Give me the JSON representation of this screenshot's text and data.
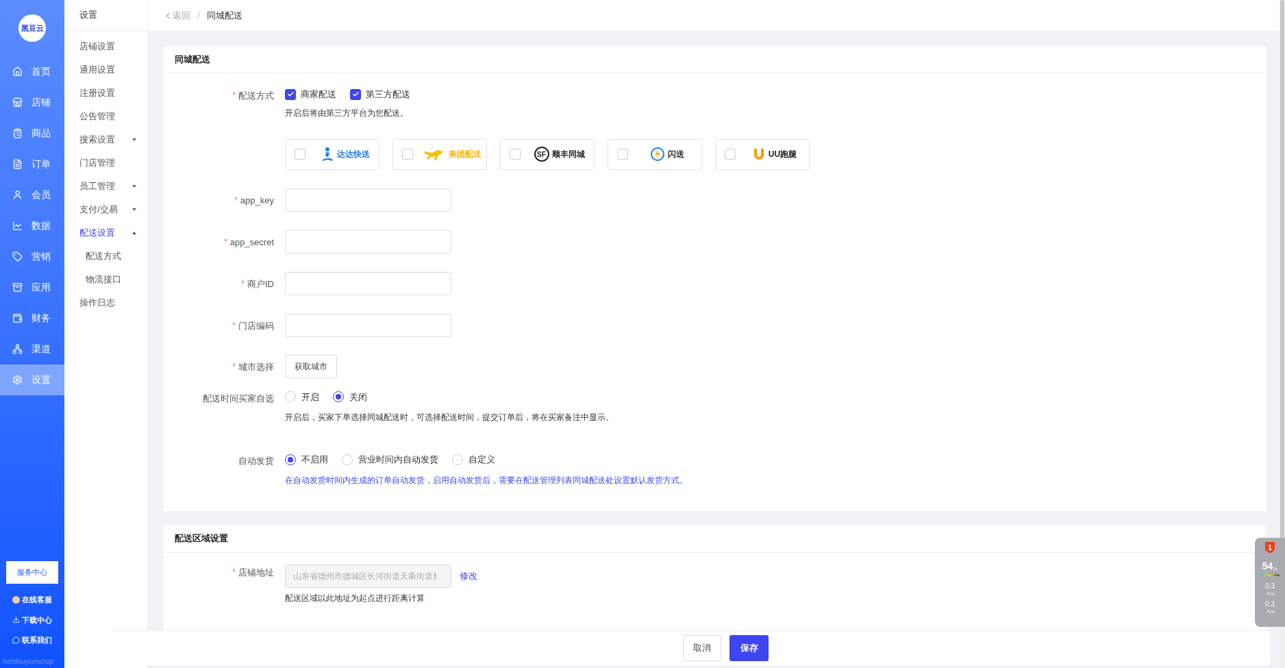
{
  "sidebar": {
    "logo": "黑豆云",
    "items": [
      {
        "label": "首页",
        "selected": false
      },
      {
        "label": "店铺",
        "selected": false
      },
      {
        "label": "商品",
        "selected": false
      },
      {
        "label": "订单",
        "selected": false
      },
      {
        "label": "会员",
        "selected": false
      },
      {
        "label": "数据",
        "selected": false
      },
      {
        "label": "营销",
        "selected": false
      },
      {
        "label": "应用",
        "selected": false
      },
      {
        "label": "财务",
        "selected": false
      },
      {
        "label": "渠道",
        "selected": false
      },
      {
        "label": "设置",
        "selected": true
      }
    ],
    "service_button": "服务中心",
    "links": [
      {
        "label": "在线客服"
      },
      {
        "label": "下载中心"
      },
      {
        "label": "联系我们"
      }
    ],
    "footer": "heidouyunshop"
  },
  "submenu": {
    "title": "设置",
    "items": [
      {
        "label": "店铺设置",
        "selected": false
      },
      {
        "label": "通用设置",
        "selected": false
      },
      {
        "label": "注册设置",
        "selected": false
      },
      {
        "label": "公告管理",
        "selected": false
      },
      {
        "label": "搜索设置",
        "selected": false,
        "expanded": false
      },
      {
        "label": "门店管理",
        "selected": false
      },
      {
        "label": "员工管理",
        "selected": false,
        "expanded": false
      },
      {
        "label": "支付/交易",
        "selected": false,
        "expanded": false
      },
      {
        "label": "配送设置",
        "selected": true,
        "expanded": true,
        "children": [
          {
            "label": "配送方式",
            "selected": false
          },
          {
            "label": "物流接口",
            "selected": false
          }
        ]
      },
      {
        "label": "操作日志",
        "selected": false
      }
    ]
  },
  "breadcrumb": {
    "back": "返回",
    "separator": "/",
    "current": "同城配送"
  },
  "section_delivery": {
    "title": "同城配送",
    "method": {
      "label": "配送方式",
      "required_mark": "*",
      "options": [
        {
          "label": "商家配送",
          "checked": true
        },
        {
          "label": "第三方配送",
          "checked": true
        }
      ],
      "hint": "开启后将由第三方平台为您配送。"
    },
    "providers": [
      {
        "name": "达达快送",
        "kind": "dada",
        "checked": false
      },
      {
        "name": "美团配送",
        "kind": "meituan",
        "checked": false
      },
      {
        "name": "顺丰同城",
        "kind": "sf",
        "logo_text": "SF",
        "checked": false
      },
      {
        "name": "闪送",
        "kind": "shansong",
        "checked": false
      },
      {
        "name": "UU跑腿",
        "kind": "uu",
        "checked": false
      }
    ],
    "fields": [
      {
        "label": "app_key",
        "required_mark": "*"
      },
      {
        "label": "app_secret",
        "required_mark": "*"
      },
      {
        "label": "商户ID",
        "required_mark": "*"
      },
      {
        "label": "门店编码",
        "required_mark": "*"
      }
    ],
    "city": {
      "label": "城市选择",
      "required_mark": "*",
      "button": "获取城市"
    },
    "buyer_time": {
      "label": "配送时间买家自选",
      "options": [
        {
          "label": "开启",
          "selected": false
        },
        {
          "label": "关闭",
          "selected": true
        }
      ],
      "hint": "开启后，买家下单选择同城配送时，可选择配送时间，提交订单后，将在买家备注中显示。"
    },
    "auto_ship": {
      "label": "自动发货",
      "options": [
        {
          "label": "不启用",
          "selected": true
        },
        {
          "label": "营业时间内自动发货",
          "selected": false
        },
        {
          "label": "自定义",
          "selected": false
        }
      ],
      "hint": "在自动发货时间内生成的订单自动发货，启用自动发货后，需要在配送管理列表同城配送处设置默认发货方式。"
    }
  },
  "section_area": {
    "title": "配送区域设置",
    "address": {
      "label": "店铺地址",
      "required_mark": "*",
      "value": "山东省德州市德城区长河街道天衢街道纟",
      "action": "修改",
      "hint": "配送区域以此地址为起点进行距离计算"
    }
  },
  "actions": {
    "cancel": "取消",
    "save": "保存"
  },
  "monitor": {
    "badge": "1",
    "percent": "54",
    "percent_unit": "%",
    "up": "0.3",
    "up_unit": "K/s",
    "down": "0.3",
    "down_unit": "K/s"
  }
}
